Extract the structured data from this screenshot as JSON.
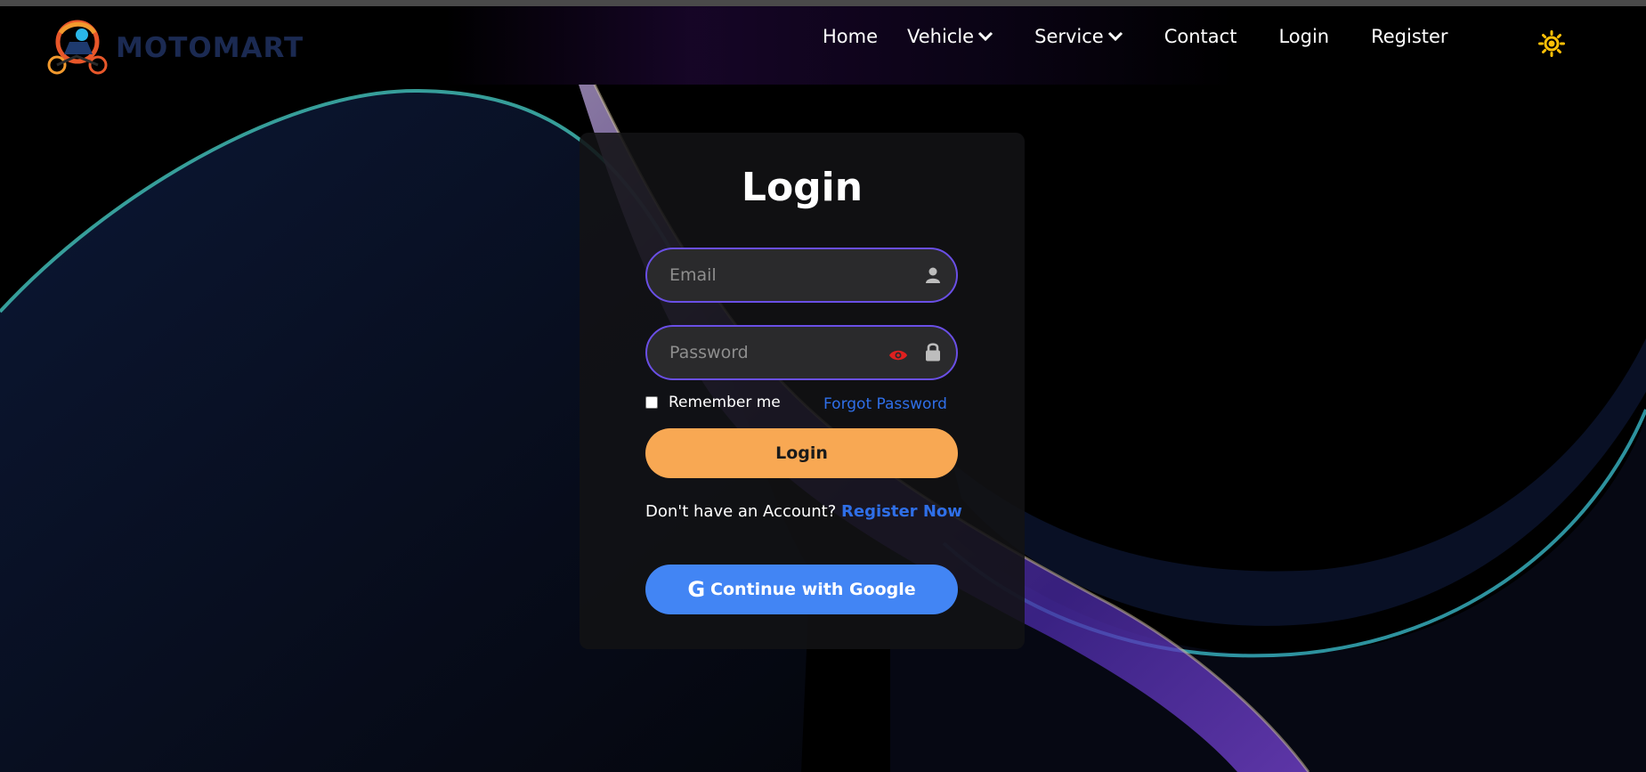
{
  "brand": {
    "name": "MOTOMART",
    "logo_icon": "motorcycle-rider-logo"
  },
  "nav": {
    "items": [
      {
        "label": "Home",
        "has_dropdown": false
      },
      {
        "label": "Vehicle",
        "has_dropdown": true
      },
      {
        "label": "Service",
        "has_dropdown": true
      },
      {
        "label": "Contact",
        "has_dropdown": false
      },
      {
        "label": "Login",
        "has_dropdown": false
      },
      {
        "label": "Register",
        "has_dropdown": false
      }
    ],
    "theme_toggle_icon": "sun-icon"
  },
  "login_form": {
    "title": "Login",
    "email": {
      "placeholder": "Email",
      "value": "",
      "icon": "user-icon"
    },
    "password": {
      "placeholder": "Password",
      "value": "",
      "icon": "lock-icon",
      "toggle_icon": "eye-icon"
    },
    "remember_label": "Remember me",
    "remember_checked": false,
    "forgot_label": "Forgot Password",
    "submit_label": "Login",
    "no_account_text": "Don't have an Account?",
    "register_link": "Register Now",
    "google_label": "Continue with Google",
    "google_glyph": "G"
  },
  "colors": {
    "accent_border": "#6a4fe6",
    "login_button": "#f8a853",
    "google_button": "#4285f4",
    "link": "#2f6fe8",
    "theme_icon": "#ffc107"
  }
}
